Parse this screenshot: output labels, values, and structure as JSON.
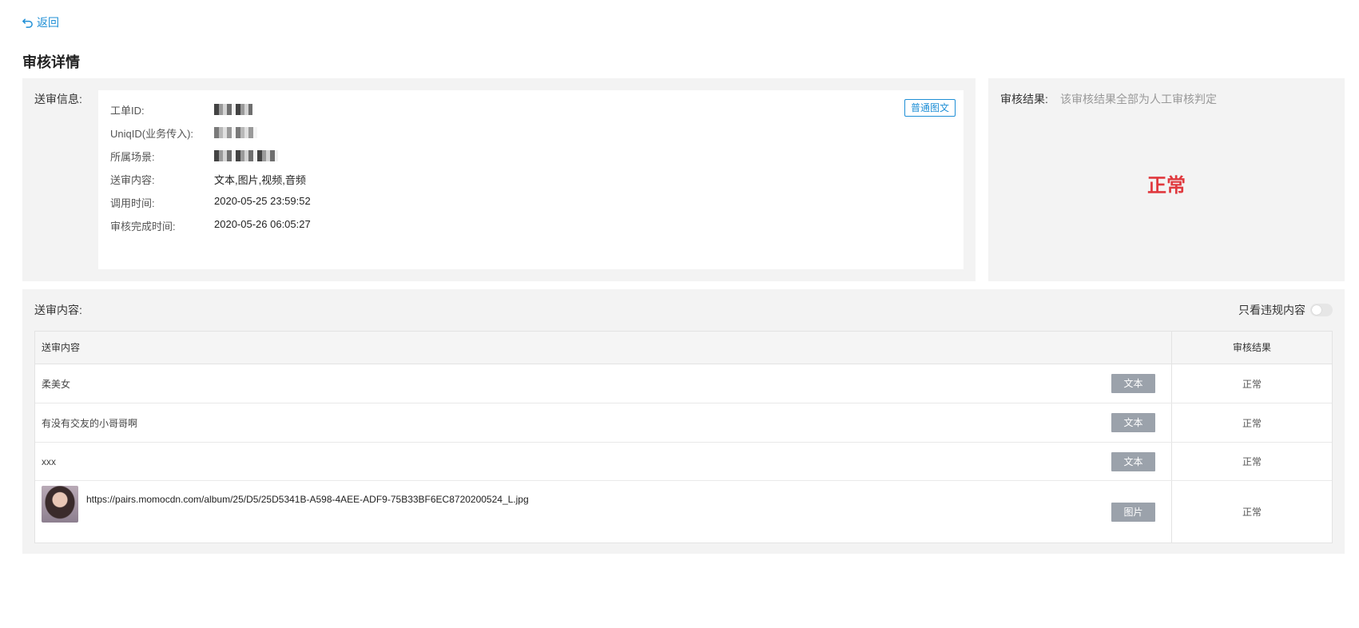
{
  "nav": {
    "back_label": "返回"
  },
  "page": {
    "title": "审核详情"
  },
  "info": {
    "label": "送审信息:",
    "type_tag": "普通图文",
    "rows": [
      {
        "key": "工单ID:",
        "value": ""
      },
      {
        "key": "UniqID(业务传入):",
        "value": ""
      },
      {
        "key": "所属场景:",
        "value": ""
      },
      {
        "key": "送审内容:",
        "value": "文本,图片,视频,音频"
      },
      {
        "key": "调用时间:",
        "value": "2020-05-25 23:59:52"
      },
      {
        "key": "审核完成时间:",
        "value": "2020-05-26 06:05:27"
      }
    ]
  },
  "result": {
    "label": "审核结果:",
    "note": "该审核结果全部为人工审核判定",
    "value": "正常",
    "value_color": "#e0393e"
  },
  "content": {
    "label": "送审内容:",
    "filter_label": "只看违规内容",
    "filter_on": false,
    "table": {
      "headers": {
        "content": "送审内容",
        "result": "审核结果"
      },
      "rows": [
        {
          "text": "柔美女",
          "type": "文本",
          "result": "正常"
        },
        {
          "text": "有没有交友的小哥哥啊",
          "type": "文本",
          "result": "正常"
        },
        {
          "text": "xxx",
          "type": "文本",
          "result": "正常"
        },
        {
          "text": "https://pairs.momocdn.com/album/25/D5/25D5341B-A598-4AEE-ADF9-75B33BF6EC8720200524_L.jpg",
          "type": "图片",
          "result": "正常"
        }
      ]
    }
  },
  "colors": {
    "accent": "#1f8fd6",
    "tag_bg": "#9ba2ab",
    "panel_bg": "#f3f3f3"
  }
}
